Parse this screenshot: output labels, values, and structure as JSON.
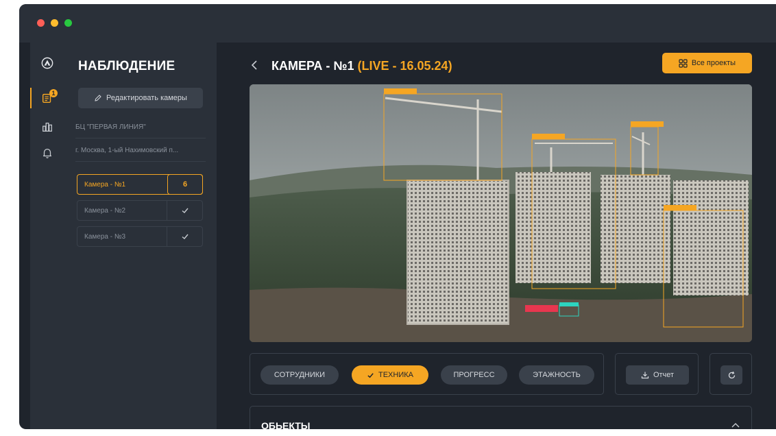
{
  "window": {
    "controls": [
      "close",
      "minimize",
      "maximize"
    ]
  },
  "rail": {
    "items": [
      {
        "icon": "logo-icon"
      },
      {
        "icon": "camera-list-icon",
        "badge": "1",
        "active": true
      },
      {
        "icon": "analytics-icon"
      },
      {
        "icon": "bell-icon"
      }
    ]
  },
  "sidebar": {
    "title": "НАБЛЮДЕНИЕ",
    "edit_button": "Редактировать камеры",
    "project_name": "БЦ \"ПЕРВАЯ ЛИНИЯ\"",
    "address": "г. Москва, 1-ый Нахимовский п...",
    "cameras": [
      {
        "label": "Камера - №1",
        "value": "6",
        "active": true
      },
      {
        "label": "Камера - №2",
        "value": "",
        "status_icon": "check-icon"
      },
      {
        "label": "Камера - №3",
        "value": "",
        "status_icon": "check-icon"
      }
    ]
  },
  "header": {
    "title": "КАМЕРА - №1",
    "live": "(LIVE - 16.05.24)",
    "all_projects": "Все проекты"
  },
  "camera": {
    "detections": [
      {
        "label": "tower_crane",
        "color": "#f5a623"
      },
      {
        "label": "tower_crane",
        "color": "#f5a623"
      },
      {
        "label": "tower_crane",
        "color": "#f5a623"
      },
      {
        "label": "tower_crane",
        "color": "#f5a623"
      },
      {
        "label": "manipulator",
        "color": "#e8364f"
      },
      {
        "label": "loader",
        "color": "#2dd4bf"
      }
    ]
  },
  "filters": {
    "items": [
      {
        "label": "СОТРУДНИКИ",
        "active": false
      },
      {
        "label": "ТЕХНИКА",
        "active": true
      },
      {
        "label": "ПРОГРЕСС",
        "active": false
      },
      {
        "label": "ЭТАЖНОСТЬ",
        "active": false
      }
    ],
    "report": "Отчет"
  },
  "objects": {
    "title": "ОБЬЕКТЫ"
  },
  "colors": {
    "accent": "#f5a623",
    "background": "#1f242c",
    "panel": "#2a3039"
  }
}
